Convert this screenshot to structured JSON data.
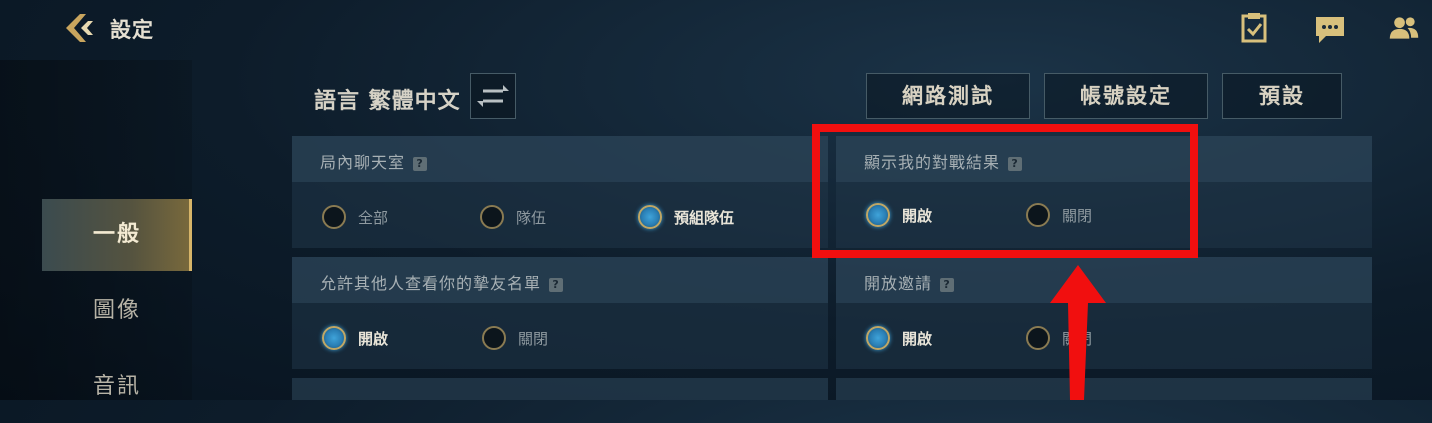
{
  "header": {
    "title": "設定"
  },
  "sidebar": {
    "items": [
      {
        "label": "一般"
      },
      {
        "label": "圖像"
      },
      {
        "label": "音訊"
      }
    ]
  },
  "language": {
    "label": "語言 繁體中文"
  },
  "buttons": {
    "network_test": "網路測試",
    "account_settings": "帳號設定",
    "default": "預設"
  },
  "sections": {
    "in_game_chat": {
      "title": "局內聊天室",
      "options": [
        "全部",
        "隊伍",
        "預組隊伍"
      ],
      "selected": "預組隊伍"
    },
    "show_results": {
      "title": "顯示我的對戰結果",
      "options": [
        "開啟",
        "關閉"
      ],
      "selected": "開啟"
    },
    "friend_list": {
      "title": "允許其他人查看你的摯友名單",
      "options": [
        "開啟",
        "關閉"
      ],
      "selected": "開啟"
    },
    "open_invite": {
      "title": "開放邀請",
      "options": [
        "開啟",
        "關閉"
      ],
      "selected": "開啟"
    }
  },
  "colors": {
    "annotation_red": "#f10f0f",
    "accent_gold": "#d7b569",
    "radio_blue": "#3fa3d9"
  },
  "icons": {
    "back": "back-chevron-icon",
    "tasks": "clipboard-check-icon",
    "chat": "chat-bubble-icon",
    "friends": "friends-icon",
    "swap": "swap-arrows-icon",
    "help": "help-icon"
  }
}
